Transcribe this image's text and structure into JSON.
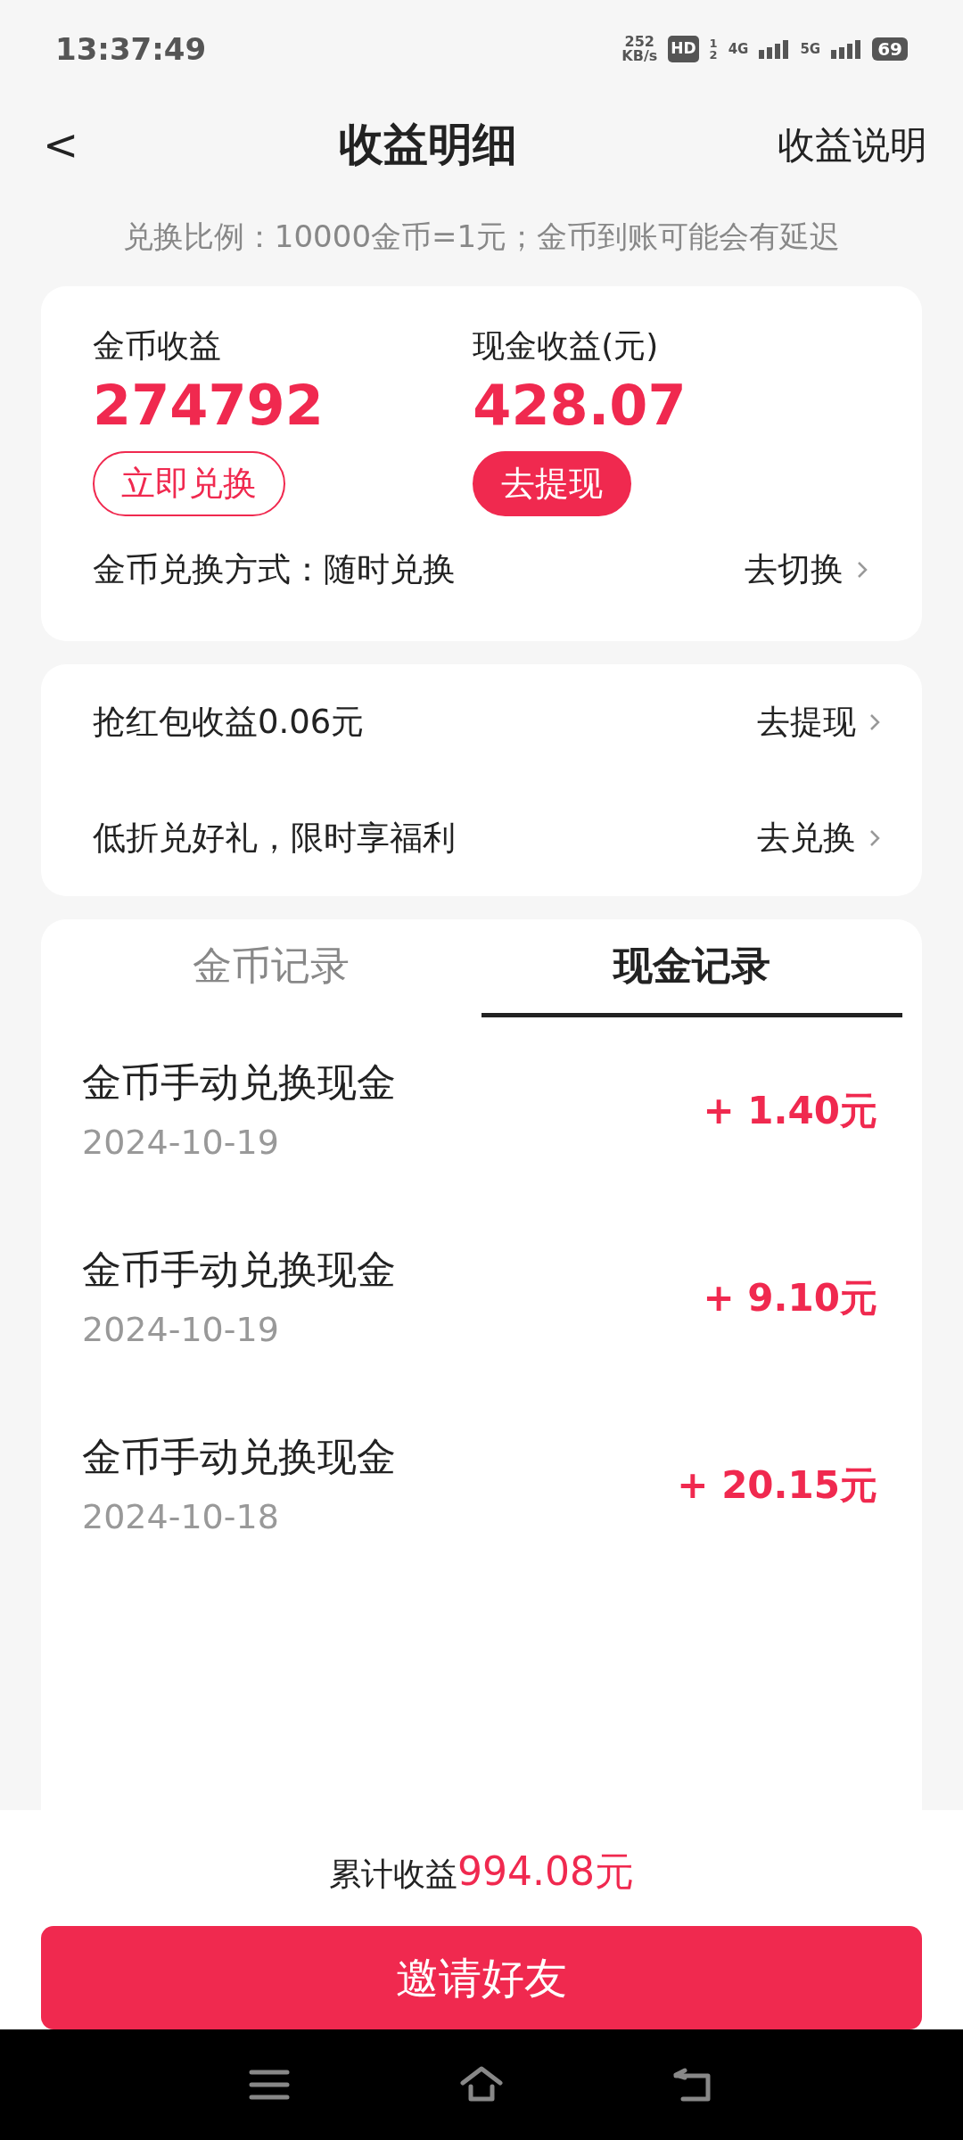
{
  "status_bar": {
    "time": "13:37:49",
    "speed": "252",
    "speed_unit": "KB/s",
    "hd": "HD",
    "hd_sim_1": "1",
    "hd_sim_2": "2",
    "net_1": "4G",
    "net_2": "5G",
    "battery": "69"
  },
  "header": {
    "back": "<",
    "title": "收益明细",
    "action": "收益说明"
  },
  "note": "兑换比例：10000金币=1元；金币到账可能会有延迟",
  "summary": {
    "stats": [
      {
        "label": "金币收益",
        "value": "274792",
        "button": "立即兑换",
        "kind": "outline"
      },
      {
        "label": "现金收益(元)",
        "value": "428.07",
        "button": "去提现",
        "kind": "filled"
      }
    ],
    "mode_row": {
      "label": "金币兑换方式：随时兑换",
      "action": "去切换"
    }
  },
  "links": [
    {
      "label": "抢红包收益0.06元",
      "action": "去提现"
    },
    {
      "label": "低折兑好礼，限时享福利",
      "action": "去兑换"
    }
  ],
  "tabs": [
    {
      "label": "金币记录",
      "selected": false
    },
    {
      "label": "现金记录",
      "selected": true
    }
  ],
  "records": [
    {
      "title": "金币手动兑换现金",
      "date": "2024-10-19",
      "amount": "+ 1.40元"
    },
    {
      "title": "金币手动兑换现金",
      "date": "2024-10-19",
      "amount": "+ 9.10元"
    },
    {
      "title": "金币手动兑换现金",
      "date": "2024-10-18",
      "amount": "+ 20.15元"
    }
  ],
  "footer": {
    "total_label": "累计收益",
    "total_value": "994.08元",
    "button": "邀请好友"
  }
}
